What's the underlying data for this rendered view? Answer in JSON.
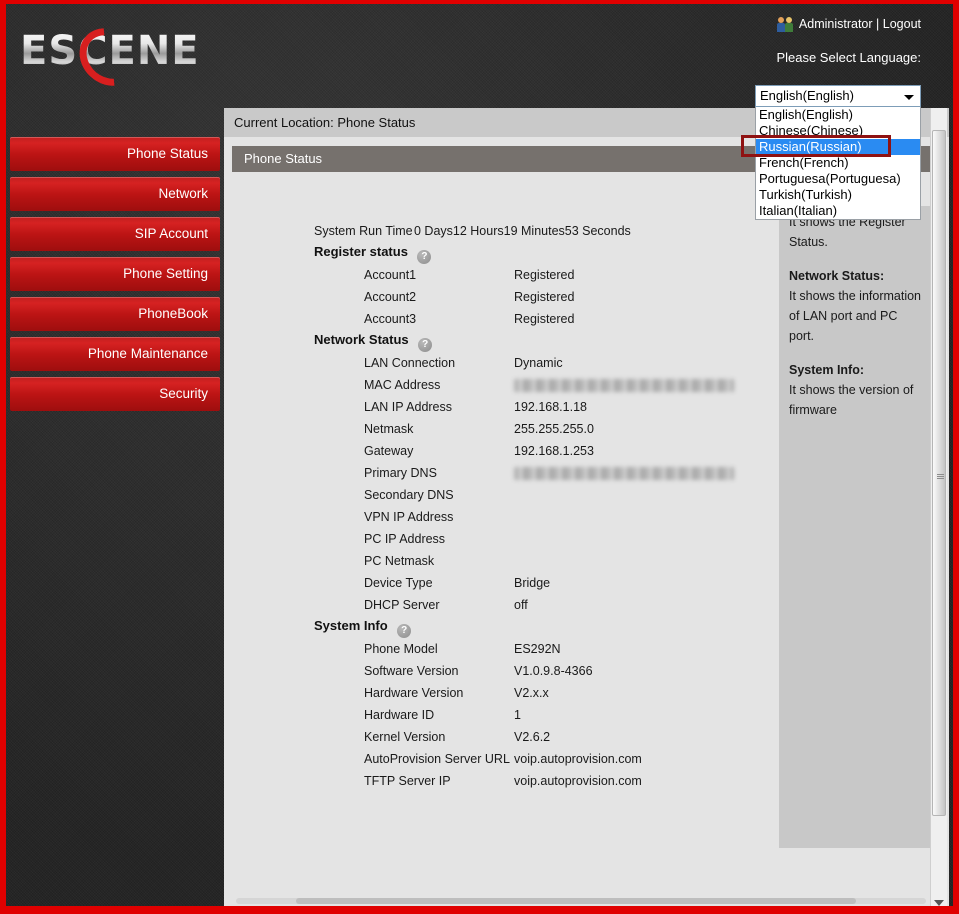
{
  "header": {
    "logo_text": "ESCENE",
    "user_label": "Administrator",
    "separator": "|",
    "logout_label": "Logout",
    "language_prompt": "Please Select Language:",
    "selected_language": "English(English)",
    "language_options": [
      "English(English)",
      "Chinese(Chinese)",
      "Russian(Russian)",
      "French(French)",
      "Portuguesa(Portuguesa)",
      "Turkish(Turkish)",
      "Italian(Italian)"
    ],
    "highlighted_option": "Russian(Russian)",
    "annotation_color": "#8f1212",
    "highlight_color": "#2a8bf2"
  },
  "sidebar": {
    "items": [
      {
        "label": "Phone Status"
      },
      {
        "label": "Network"
      },
      {
        "label": "SIP Account"
      },
      {
        "label": "Phone Setting"
      },
      {
        "label": "PhoneBook"
      },
      {
        "label": "Phone Maintenance"
      },
      {
        "label": "Security"
      }
    ]
  },
  "content": {
    "breadcrumb": "Current Location: Phone Status",
    "panel_title": "Phone Status",
    "system_run_time_label": "System Run Time",
    "system_run_time_value": "0 Days12 Hours19 Minutes53 Seconds",
    "groups": {
      "register_status": {
        "label": "Register status",
        "help": "?",
        "rows": [
          {
            "key": "Account1",
            "value": "Registered"
          },
          {
            "key": "Account2",
            "value": "Registered"
          },
          {
            "key": "Account3",
            "value": "Registered"
          }
        ]
      },
      "network_status": {
        "label": "Network Status",
        "help": "?",
        "rows": [
          {
            "key": "LAN Connection",
            "value": "Dynamic"
          },
          {
            "key": "MAC Address",
            "value": ""
          },
          {
            "key": "LAN IP Address",
            "value": "192.168.1.18"
          },
          {
            "key": "Netmask",
            "value": "255.255.255.0"
          },
          {
            "key": "Gateway",
            "value": "192.168.1.253"
          },
          {
            "key": "Primary DNS",
            "value": ""
          },
          {
            "key": "Secondary DNS",
            "value": ""
          },
          {
            "key": "VPN IP Address",
            "value": ""
          },
          {
            "key": "PC IP Address",
            "value": ""
          },
          {
            "key": "PC Netmask",
            "value": ""
          },
          {
            "key": "Device Type",
            "value": "Bridge"
          },
          {
            "key": "DHCP Server",
            "value": "off"
          }
        ]
      },
      "system_info": {
        "label": "System Info",
        "help": "?",
        "rows": [
          {
            "key": "Phone Model",
            "value": "ES292N"
          },
          {
            "key": "Software Version",
            "value": "V1.0.9.8-4366"
          },
          {
            "key": "Hardware Version",
            "value": "V2.x.x"
          },
          {
            "key": "Hardware ID",
            "value": "1"
          },
          {
            "key": "Kernel Version",
            "value": "V2.6.2"
          },
          {
            "key": "AutoProvision Server URL",
            "value": "voip.autoprovision.com"
          },
          {
            "key": "TFTP Server IP",
            "value": "voip.autoprovision.com"
          }
        ]
      }
    },
    "help_panel": {
      "register_text": "It shows the Register Status.",
      "network_heading": "Network Status:",
      "network_text": "It shows the information of LAN port and PC port.",
      "system_heading": "System Info:",
      "system_text": "It shows the version of firmware"
    }
  }
}
